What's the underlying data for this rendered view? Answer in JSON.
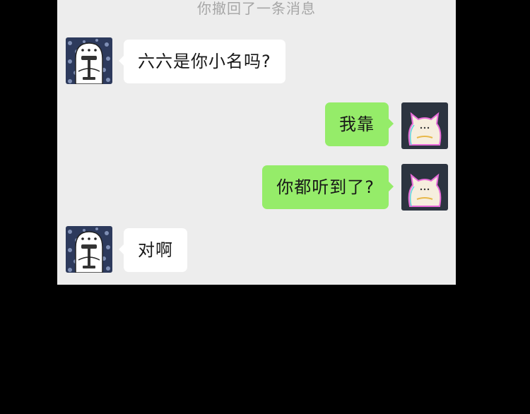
{
  "chat": {
    "system_notice": "你撤回了一条消息",
    "messages": [
      {
        "sender": "other",
        "text": "六六是你小名吗?"
      },
      {
        "sender": "self",
        "text": "我靠"
      },
      {
        "sender": "self",
        "text": "你都听到了?"
      },
      {
        "sender": "other",
        "text": "对啊"
      }
    ]
  },
  "icons": {
    "other_avatar": "cartoon-character-avatar",
    "self_avatar": "fluffy-cat-avatar"
  },
  "colors": {
    "background": "#000000",
    "chat_background": "#ededed",
    "incoming_bubble": "#ffffff",
    "outgoing_bubble": "#95ec69",
    "notice_text": "#a6a6a6"
  }
}
